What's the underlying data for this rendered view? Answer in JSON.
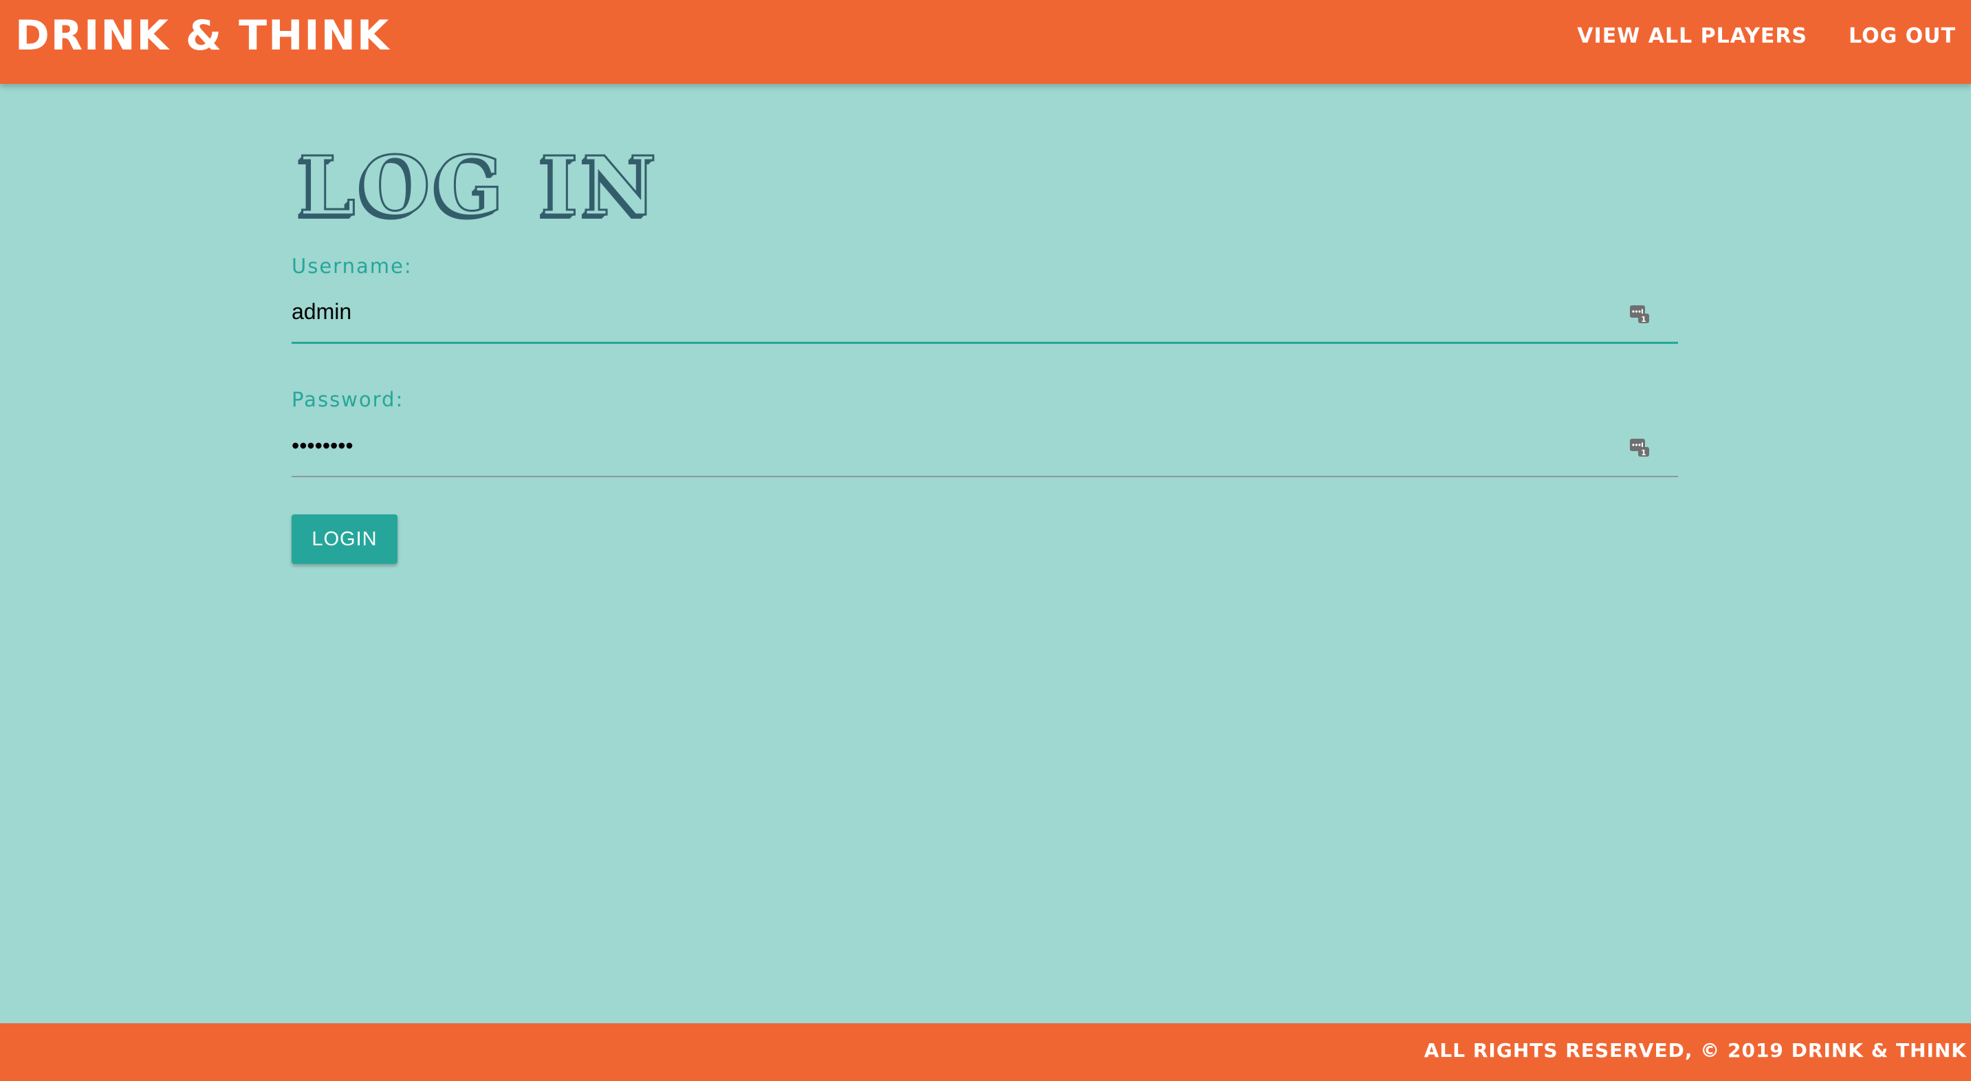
{
  "header": {
    "brand": "DRINK & THINK",
    "nav": [
      {
        "label": "VIEW ALL PLAYERS"
      },
      {
        "label": "LOG OUT"
      }
    ]
  },
  "main": {
    "title": "LOG IN",
    "username": {
      "label": "Username:",
      "value": "admin",
      "icon": "password-manager-icon"
    },
    "password": {
      "label": "Password:",
      "value": "••••••••",
      "icon": "password-manager-icon"
    },
    "submit_label": "LOGIN"
  },
  "footer": {
    "text": "ALL RIGHTS RESERVED, © 2019 DRINK & THINK"
  },
  "colors": {
    "header_bg": "#f06633",
    "page_bg": "#9fd7d1",
    "accent": "#26a69a",
    "title_shadow": "#345d6b"
  }
}
